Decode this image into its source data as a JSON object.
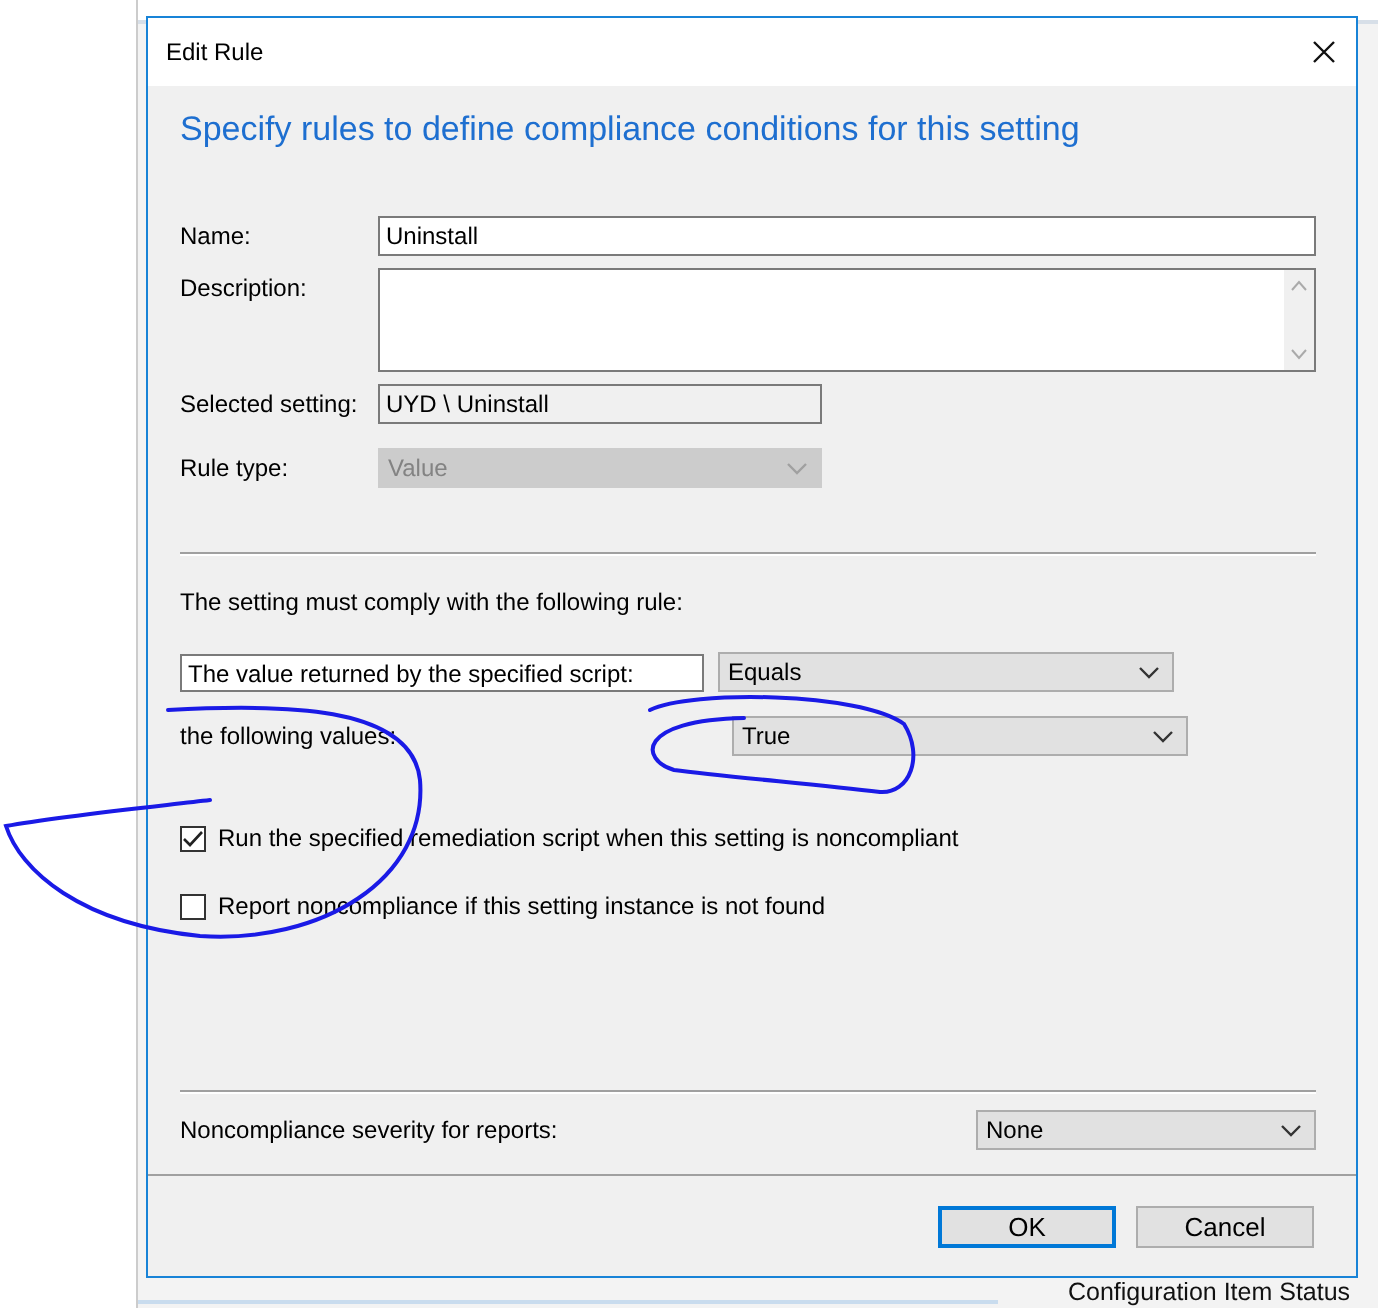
{
  "background": {
    "status_text": "Configuration Item Status"
  },
  "dialog": {
    "title": "Edit Rule",
    "heading": "Specify rules to define compliance conditions for this setting",
    "fields": [
      {
        "kind": "text",
        "label": "Name:",
        "value": "Uninstall",
        "disabled": false
      },
      {
        "kind": "textarea",
        "label": "Description:",
        "disabled": false
      },
      {
        "kind": "readonly",
        "label": "Selected setting:",
        "value": "UYD \\ Uninstall",
        "disabled": false
      },
      {
        "kind": "dropdown",
        "label": "Rule type:",
        "value": "Value",
        "disabled": true
      }
    ],
    "rule": {
      "intro": "The setting must comply with the following rule:",
      "source": "The value returned by the specified script:",
      "operator": "Equals",
      "values_label": "the following values:",
      "value": "True"
    },
    "options": [
      {
        "label": "Run the specified remediation script when this setting is noncompliant",
        "checked": true
      },
      {
        "label": "Report noncompliance if this setting instance is not found",
        "checked": false
      }
    ],
    "severity": {
      "label": "Noncompliance severity for reports:",
      "value": "None"
    },
    "buttons": [
      {
        "label": "OK",
        "focused": true
      },
      {
        "label": "Cancel",
        "focused": false
      }
    ]
  }
}
